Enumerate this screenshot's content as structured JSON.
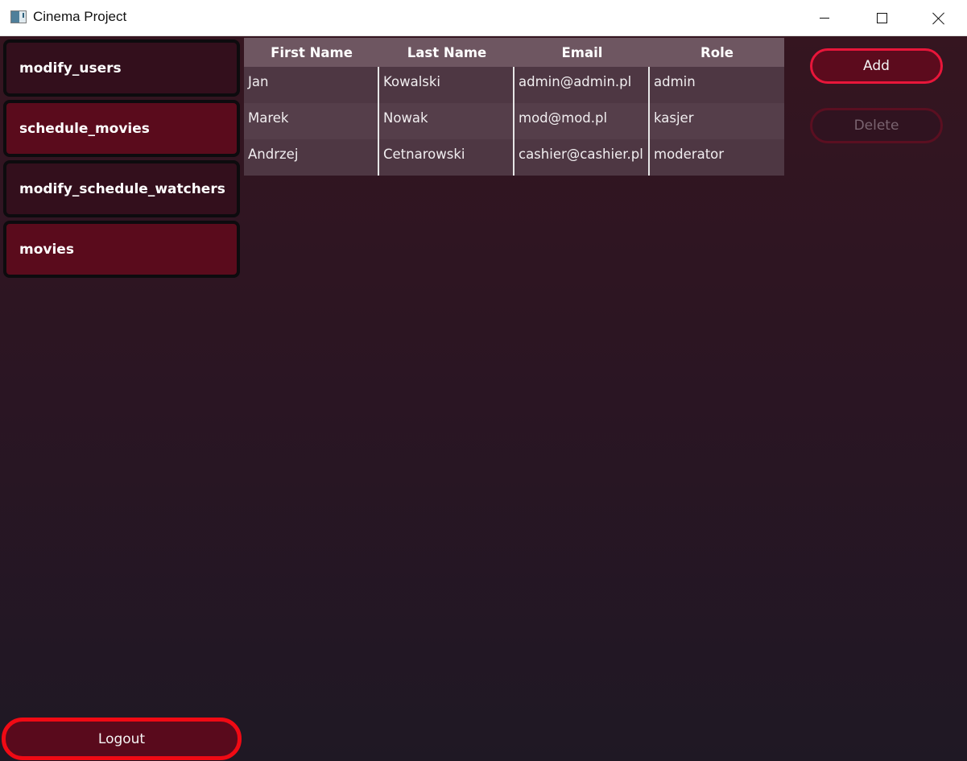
{
  "window": {
    "title": "Cinema Project"
  },
  "sidebar": {
    "items": [
      {
        "label": "modify_users"
      },
      {
        "label": "schedule_movies"
      },
      {
        "label": "modify_schedule_watchers"
      },
      {
        "label": "movies"
      }
    ],
    "logout_label": "Logout"
  },
  "table": {
    "columns": [
      "First Name",
      "Last Name",
      "Email",
      "Role"
    ],
    "rows": [
      [
        "Jan",
        "Kowalski",
        "admin@admin.pl",
        "admin"
      ],
      [
        "Marek",
        "Nowak",
        "mod@mod.pl",
        "kasjer"
      ],
      [
        "Andrzej",
        "Cetnarowski",
        "cashier@cashier.pl",
        "moderator"
      ]
    ]
  },
  "actions": {
    "add_label": "Add",
    "delete_label": "Delete",
    "delete_enabled": false
  },
  "colors": {
    "accent": "#e8163a",
    "logout_border": "#f00a14",
    "button_fill": "#5a0b1c"
  },
  "icons": {
    "app": "app-window-icon",
    "minimize": "minimize-icon",
    "maximize": "maximize-icon",
    "close": "close-icon"
  }
}
